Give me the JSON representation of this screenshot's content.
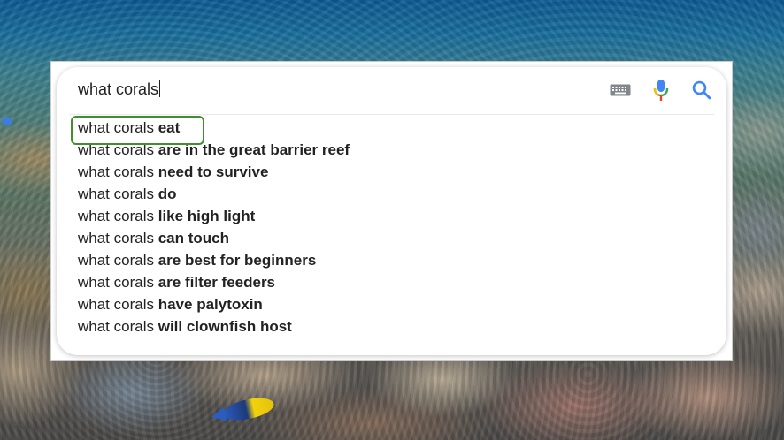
{
  "search": {
    "query": "what corals",
    "icons": [
      "keyboard-icon",
      "microphone-icon",
      "search-icon"
    ]
  },
  "suggestions": [
    {
      "prefix": "what corals",
      "completion": "eat"
    },
    {
      "prefix": "what corals",
      "completion": "are in the great barrier reef"
    },
    {
      "prefix": "what corals",
      "completion": "need to survive"
    },
    {
      "prefix": "what corals",
      "completion": "do"
    },
    {
      "prefix": "what corals",
      "completion": "like high light"
    },
    {
      "prefix": "what corals",
      "completion": "can touch"
    },
    {
      "prefix": "what corals",
      "completion": "are best for beginners"
    },
    {
      "prefix": "what corals",
      "completion": "are filter feeders"
    },
    {
      "prefix": "what corals",
      "completion": "have palytoxin"
    },
    {
      "prefix": "what corals",
      "completion": "will clownfish host"
    }
  ],
  "colors": {
    "highlight_border": "#3f8f2f",
    "mic_blue": "#4285f4",
    "mic_red": "#ea4335",
    "mic_yellow": "#fbbc05",
    "mic_green": "#34a853",
    "search_icon": "#4285f4"
  }
}
